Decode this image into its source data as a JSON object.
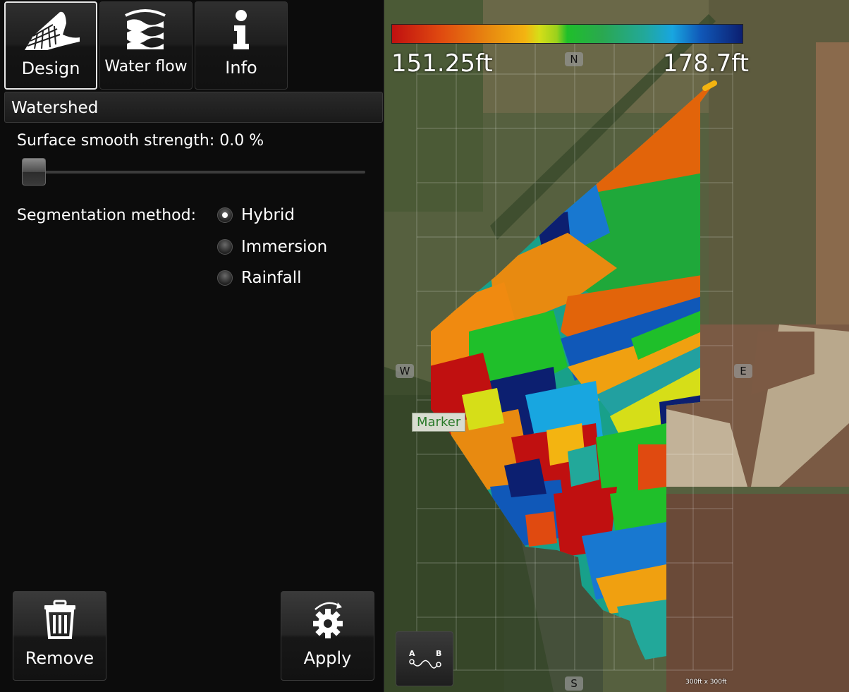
{
  "tabs": [
    {
      "label": "Design",
      "icon": "field-design-icon",
      "active": true
    },
    {
      "label": "Water flow",
      "icon": "water-flow-icon",
      "active": false
    },
    {
      "label": "Info",
      "icon": "info-icon",
      "active": false
    }
  ],
  "section": {
    "title": "Watershed"
  },
  "smooth": {
    "label": "Surface smooth strength:",
    "value": "0.0 %",
    "fraction": 0.0
  },
  "segmentation": {
    "label": "Segmentation method:",
    "options": [
      {
        "label": "Hybrid",
        "checked": true
      },
      {
        "label": "Immersion",
        "checked": false
      },
      {
        "label": "Rainfall",
        "checked": false
      }
    ]
  },
  "actions": {
    "remove_label": "Remove",
    "apply_label": "Apply"
  },
  "map": {
    "legend": {
      "min": "151.25ft",
      "max": "178.7ft"
    },
    "compass": {
      "n": "N",
      "s": "S",
      "w": "W",
      "e": "E"
    },
    "marker": "Marker",
    "profile_labels": {
      "a": "A",
      "b": "B"
    },
    "scale": "300ft x 300ft"
  },
  "colors": {
    "palette": [
      "#c01010",
      "#e04a10",
      "#e88a10",
      "#f3b411",
      "#d6de18",
      "#1fbf2a",
      "#2aa850",
      "#22a89a",
      "#18a6e0",
      "#1058b8",
      "#0c1f70"
    ]
  }
}
